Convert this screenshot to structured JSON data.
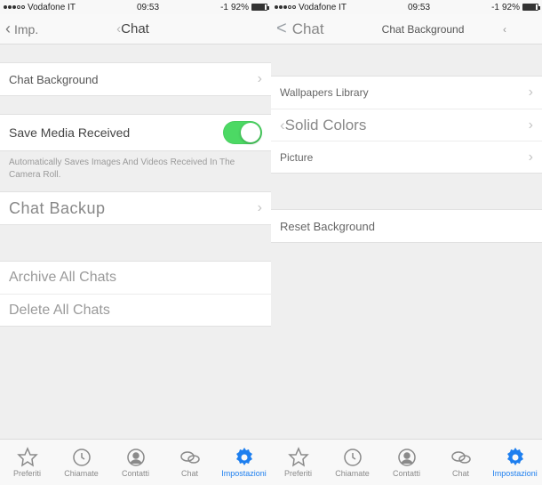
{
  "status": {
    "carrier": "Vodafone IT",
    "time": "09:53",
    "battery_text": "92%",
    "battery_prefix": "-1"
  },
  "left_phone": {
    "nav": {
      "back_label": "Imp.",
      "title": "Chat"
    },
    "rows": {
      "chat_background": "Chat Background",
      "save_media": "Save Media Received",
      "save_media_desc": "Automatically Saves Images And Videos Received In The Camera Roll.",
      "chat_backup": "Chat Backup",
      "archive_all": "Archive All Chats",
      "delete_all": "Delete All Chats"
    },
    "save_media_enabled": true
  },
  "right_phone": {
    "nav": {
      "back_label": "Chat",
      "title": "Chat Background"
    },
    "rows": {
      "wallpapers": "Wallpapers Library",
      "solid_colors": "Solid Colors",
      "picture": "Picture",
      "reset": "Reset Background"
    }
  },
  "tabs": [
    {
      "key": "preferiti",
      "label": "Preferiti",
      "active": false
    },
    {
      "key": "chiamate",
      "label": "Chiamate",
      "active": false
    },
    {
      "key": "contatti",
      "label": "Contatti",
      "active": false
    },
    {
      "key": "chat",
      "label": "Chat",
      "active": false
    },
    {
      "key": "impostazioni",
      "label": "Impostazioni",
      "active": true
    }
  ],
  "colors": {
    "active": "#1e7fef",
    "toggle_on": "#4cd964",
    "inactive": "#8a8a8a"
  }
}
